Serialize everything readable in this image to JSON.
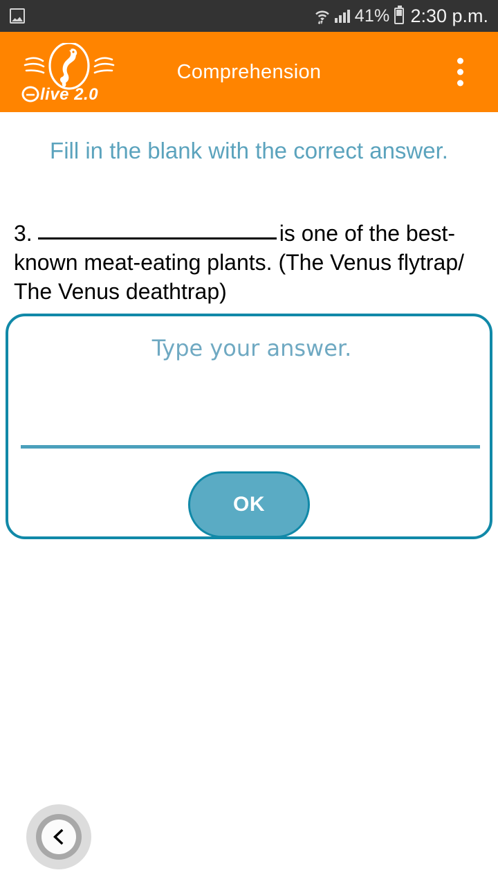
{
  "status_bar": {
    "notification_icon": "image-icon",
    "wifi_icon": "wifi-icon",
    "signal_icon": "signal-bars-icon",
    "battery_percent": "41%",
    "battery_icon": "battery-icon",
    "time": "2:30 p.m."
  },
  "app_bar": {
    "logo_alt": "elive 2.0",
    "logo_wordmark": "elive 2.0",
    "title": "Comprehension",
    "overflow_icon": "more-vertical-icon",
    "background_color": "#FF8400"
  },
  "content": {
    "instruction": "Fill in the blank with the correct answer.",
    "instruction_color": "#5BA3BD",
    "question_number": "3.",
    "question_before_blank": "3.",
    "question_after_blank": "is one of the best-known meat-eating plants. (The Venus flytrap/ The Venus deathtrap)"
  },
  "answer_card": {
    "placeholder": "Type your answer.",
    "value": "",
    "border_color": "#1189A8",
    "divider_color": "#4BA0BC",
    "ok_label": "OK",
    "ok_fill_color": "#5AABC4"
  },
  "navigation": {
    "back_icon": "chevron-left-icon"
  }
}
